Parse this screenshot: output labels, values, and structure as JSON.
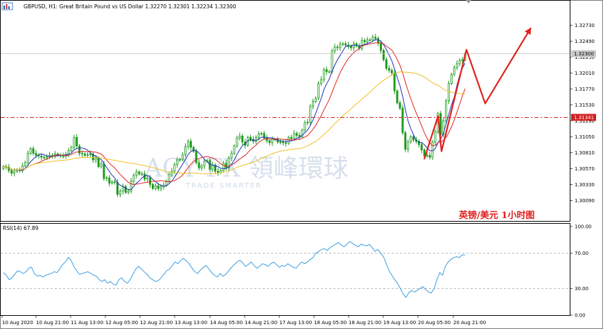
{
  "header": {
    "title": "GBPUSD, H1:  Great Britain Pound vs US Dollar  1.32270 1.32301 1.32234 1.32300"
  },
  "watermark": {
    "brand": "ACY FX 領峰環球",
    "tagline": "TRADE SMARTER"
  },
  "caption": "英镑/美元 1小时图",
  "colors": {
    "candle": "#1a9a1a",
    "ma_fast": "#1f2fbf",
    "ma_mid": "#e0201c",
    "ma_slow": "#f0c020",
    "level_line": "#d02020",
    "arrows": "#e0201c",
    "rsi": "#3a9de0",
    "price_tag_bg": "#c8c8c8",
    "level_tag_bg": "#d02020"
  },
  "chart_data": [
    {
      "type": "candlestick",
      "title": "GBPUSD, H1",
      "series": [
        {
          "name": "GBPUSD",
          "close": [
            1.306,
            1.3059,
            1.3054,
            1.305,
            1.3053,
            1.3055,
            1.3054,
            1.3061,
            1.3066,
            1.308,
            1.3087,
            1.308,
            1.3077,
            1.3076,
            1.3074,
            1.3073,
            1.3075,
            1.3077,
            1.3077,
            1.3079,
            1.3077,
            1.3076,
            1.3076,
            1.3079,
            1.3084,
            1.3089,
            1.3104,
            1.3091,
            1.308,
            1.3079,
            1.3077,
            1.3078,
            1.3079,
            1.307,
            1.3073,
            1.306,
            1.3064,
            1.3042,
            1.3043,
            1.3035,
            1.3037,
            1.3036,
            1.3018,
            1.3023,
            1.303,
            1.3021,
            1.3023,
            1.3038,
            1.3047,
            1.3052,
            1.3049,
            1.3049,
            1.3041,
            1.3043,
            1.3033,
            1.3027,
            1.3031,
            1.3027,
            1.303,
            1.3032,
            1.3038,
            1.3048,
            1.3053,
            1.3063,
            1.307,
            1.3071,
            1.3078,
            1.309,
            1.3098,
            1.3089,
            1.3083,
            1.3066,
            1.3058,
            1.3061,
            1.3068,
            1.3069,
            1.3056,
            1.3062,
            1.3053,
            1.3051,
            1.3054,
            1.3065,
            1.3058,
            1.3073,
            1.308,
            1.3091,
            1.3103,
            1.3106,
            1.3097,
            1.3092,
            1.3104,
            1.3101,
            1.3098,
            1.3104,
            1.3109,
            1.311,
            1.3103,
            1.3099,
            1.3096,
            1.3101,
            1.3101,
            1.3097,
            1.3097,
            1.3096,
            1.3095,
            1.3104,
            1.3102,
            1.311,
            1.3107,
            1.3105,
            1.3115,
            1.3126,
            1.3127,
            1.3151,
            1.3158,
            1.3163,
            1.3185,
            1.3191,
            1.3206,
            1.3203,
            1.3203,
            1.3234,
            1.324,
            1.3239,
            1.3244,
            1.3245,
            1.3243,
            1.3241,
            1.3239,
            1.3245,
            1.3242,
            1.3238,
            1.325,
            1.3248,
            1.3251,
            1.3251,
            1.3255,
            1.3253,
            1.3246,
            1.3235,
            1.3221,
            1.3208,
            1.3205,
            1.3201,
            1.3174,
            1.3156,
            1.3148,
            1.3111,
            1.3086,
            1.3097,
            1.3105,
            1.31,
            1.3098,
            1.3093,
            1.3085,
            1.3076,
            1.3077,
            1.3074,
            1.3097,
            1.3112,
            1.314,
            1.3108,
            1.3129,
            1.3159,
            1.3185,
            1.3199,
            1.3209,
            1.3215,
            1.322,
            1.3221,
            1.323
          ]
        },
        {
          "name": "",
          "type": "line",
          "color": "blue"
        },
        {
          "name": "",
          "type": "line",
          "color": "red"
        },
        {
          "name": "",
          "type": "line",
          "color": "yellow"
        }
      ],
      "y_ticks": [
        "1.32730",
        "1.32490",
        "1.32250",
        "1.32010",
        "1.31770",
        "1.31530",
        "1.31290",
        "1.31050",
        "1.30810",
        "1.30570",
        "1.30330",
        "1.30090"
      ],
      "ylim": [
        1.3,
        1.329
      ],
      "current_price": "1.32300",
      "level_value": "1.31341",
      "grid": false,
      "annotations": "red arrows showing projected zig-zag path up, down, then up"
    },
    {
      "type": "line",
      "title": "RSI(14) 67.89",
      "series": [
        {
          "name": "RSI(14)",
          "values": [
            48,
            45,
            40,
            42,
            46,
            50,
            49,
            47,
            49,
            53,
            54,
            47,
            44,
            45,
            43,
            45,
            46,
            47,
            49,
            48,
            52,
            57,
            60,
            65,
            62,
            55,
            50,
            46,
            47,
            48,
            49,
            47,
            45,
            44,
            40,
            38,
            40,
            36,
            38,
            35,
            34,
            40,
            42,
            38,
            36,
            40,
            46,
            52,
            55,
            52,
            49,
            46,
            42,
            40,
            38,
            39,
            42,
            46,
            50,
            52,
            56,
            60,
            58,
            62,
            64,
            61,
            58,
            53,
            49,
            47,
            51,
            54,
            56,
            52,
            48,
            45,
            43,
            47,
            44,
            46,
            50,
            54,
            57,
            60,
            62,
            59,
            55,
            57,
            60,
            56,
            53,
            55,
            58,
            57,
            55,
            58,
            60,
            57,
            54,
            56,
            55,
            58,
            56,
            54,
            53,
            57,
            60,
            58,
            60,
            63,
            65,
            70,
            72,
            74,
            75,
            73,
            76,
            78,
            80,
            82,
            79,
            77,
            80,
            83,
            81,
            79,
            77,
            80,
            79,
            78,
            80,
            76,
            72,
            74,
            70,
            66,
            58,
            50,
            45,
            40,
            36,
            30,
            24,
            20,
            25,
            28,
            26,
            28,
            30,
            32,
            29,
            26,
            25,
            30,
            40,
            48,
            45,
            55,
            60,
            63,
            65,
            66,
            65,
            68,
            67.89
          ],
          "color": "#3a9de0"
        }
      ],
      "y_ticks": [
        "100.00",
        "70.00",
        "30.00",
        "0.00"
      ],
      "ylim": [
        0,
        100
      ],
      "levels": [
        70,
        30
      ],
      "x_ticks": [
        "10 Aug 2020",
        "10 Aug 21:00",
        "11 Aug 13:00",
        "12 Aug 05:00",
        "12 Aug 21:00",
        "13 Aug 13:00",
        "14 Aug 05:00",
        "14 Aug 21:00",
        "17 Aug 13:00",
        "18 Aug 05:00",
        "18 Aug 21:00",
        "19 Aug 13:00",
        "20 Aug 05:00",
        "20 Aug 21:00"
      ]
    }
  ]
}
